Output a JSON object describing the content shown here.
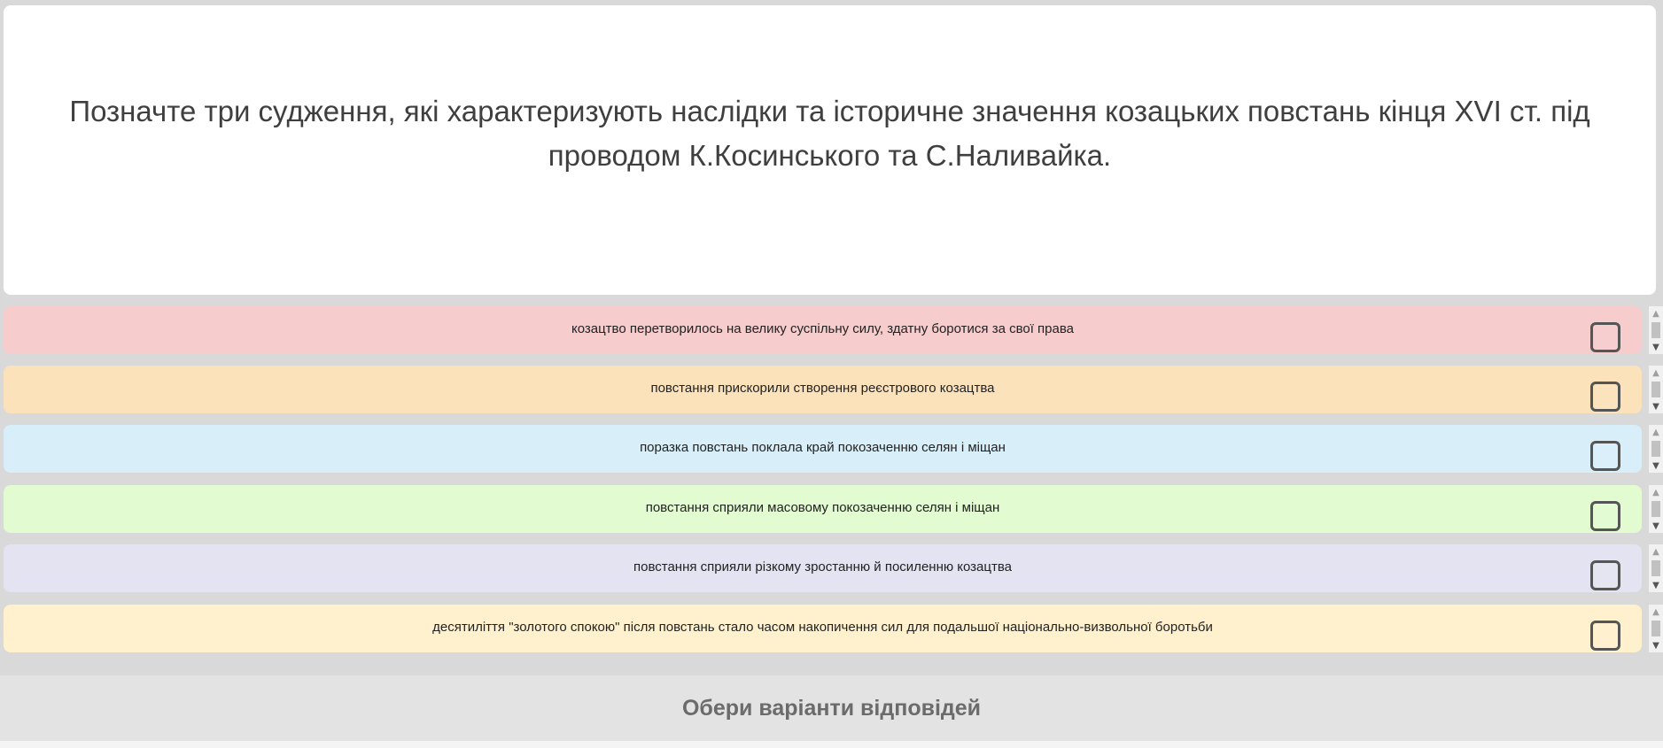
{
  "question": {
    "text": "Позначте три судження, які характеризують наслідки та історичне значення козацьких повстань кінця XVI ст. під проводом К.Косинського та С.Наливайка."
  },
  "options": [
    {
      "label": "козацтво перетворилось на велику суспільну силу, здатну боротися за свої права",
      "color": "#f6cccd",
      "checked": false
    },
    {
      "label": "повстання прискорили створення реєстрового козацтва",
      "color": "#fbe2bb",
      "checked": false
    },
    {
      "label": "поразка повстань поклала край покозаченню селян і міщан",
      "color": "#d8eff9",
      "checked": false
    },
    {
      "label": "повстання сприяли масовому покозаченню селян і міщан",
      "color": "#e2fbd1",
      "checked": false
    },
    {
      "label": "повстання сприяли різкому зростанню й посиленню козацтва",
      "color": "#e4e3f1",
      "checked": false
    },
    {
      "label": "десятиліття \"золотого спокою\" після повстань стало часом накопичення сил для подальшої національно-визвольної боротьби",
      "color": "#fff1ce",
      "checked": false
    }
  ],
  "scrollbar": {
    "up_icon": "▲",
    "down_icon": "▼"
  },
  "submit": {
    "label": "Обери варіанти відповідей"
  }
}
